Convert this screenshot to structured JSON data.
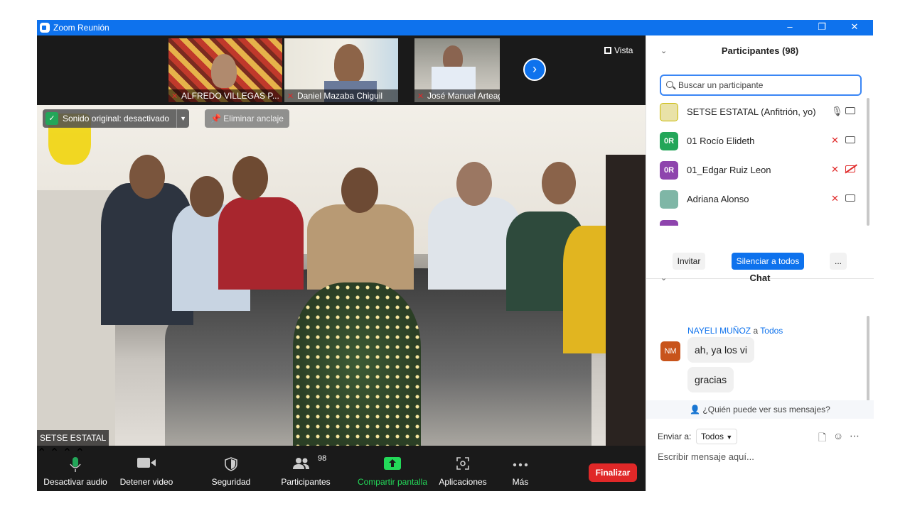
{
  "window": {
    "title": "Zoom Reunión",
    "controls": [
      "–",
      "❐",
      "✕"
    ]
  },
  "strip": {
    "thumbnails": [
      {
        "name": "ALFREDO VILLEGAS P..."
      },
      {
        "name": "Daniel Mazaba Chiguil"
      },
      {
        "name": "José Manuel Arteaga..."
      }
    ],
    "next_icon": "›",
    "view_label": "Vista"
  },
  "main_video": {
    "speaker": "SETSE ESTATAL",
    "original_sound": "Sonido original: desactivado",
    "unpin": "Eliminar anclaje"
  },
  "toolbar": {
    "mute_label": "Desactivar audio",
    "video_label": "Detener video",
    "security_label": "Seguridad",
    "participants_label": "Participantes",
    "participants_count": "98",
    "share_label": "Compartir pantalla",
    "apps_label": "Aplicaciones",
    "more_label": "Más",
    "end_label": "Finalizar",
    "share_color": "#23d959"
  },
  "participants_panel": {
    "title": "Participantes (98)",
    "search_placeholder": "Buscar un participante",
    "rows": [
      {
        "name": "SETSE ESTATAL (Anfitrión, yo)",
        "initials": "",
        "color": "#e9e2a8",
        "muted": false,
        "video_off": false
      },
      {
        "name": "01 Rocío Elideth",
        "initials": "0R",
        "color": "#23a659",
        "muted": true,
        "video_off": false
      },
      {
        "name": "01_Edgar Ruiz Leon",
        "initials": "0R",
        "color": "#8e44ad",
        "muted": true,
        "video_off": true
      },
      {
        "name": "Adriana Alonso",
        "initials": "",
        "color": "#7fb6a6",
        "muted": true,
        "video_off": false
      }
    ],
    "invite_label": "Invitar",
    "mute_all_label": "Silenciar a todos",
    "more_label": "..."
  },
  "chat_panel": {
    "title": "Chat",
    "sender": "NAYELI MUÑOZ",
    "sender_to": "a",
    "recipient": "Todos",
    "sender_initials": "NM",
    "messages": [
      "ah, ya los vi",
      "gracias"
    ],
    "who_can_see": "¿Quién puede ver sus mensajes?",
    "send_to_label": "Enviar a:",
    "send_to_value": "Todos",
    "input_placeholder": "Escribir mensaje aquí..."
  }
}
